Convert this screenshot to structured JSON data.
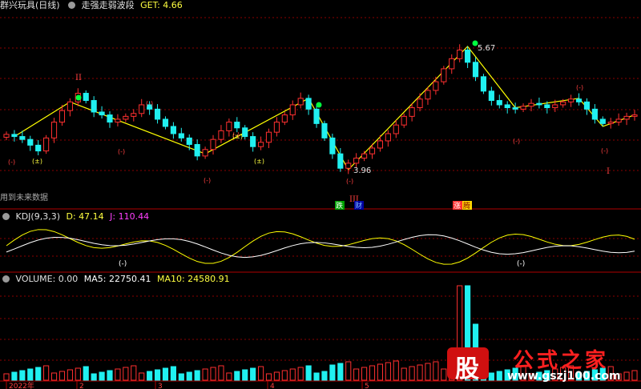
{
  "header": {
    "stock_name": "群兴玩具(日线)",
    "indicator_name": "走强走弱波段",
    "get_label": "GET: 4.66",
    "future_data_label": "用到未来数据"
  },
  "kdj_header": {
    "name": "KDJ(9,3,3)",
    "d_label": "D: 47.14",
    "j_label": "J: 110.44"
  },
  "volume_header": {
    "name": "VOLUME: 0.00",
    "ma5_label": "MA5: 22750.41",
    "ma10_label": "MA10: 24580.91"
  },
  "colors": {
    "up": "#ff3030",
    "down": "#20f0f0",
    "grid": "#8b0000",
    "zigzag": "#ffff00",
    "kdj_k": "#ffffff",
    "kdj_d": "#ffff00"
  },
  "annotations": {
    "price_high": "5.67",
    "price_low": "3.96",
    "roman_top": "II",
    "roman_bottom_left": "III",
    "roman_bottom_right": "I",
    "signal_down": "跌",
    "signal_buy": "财",
    "signal_up": "涨",
    "signal_soar": "腾",
    "kdj_marker_1": "(-)",
    "kdj_marker_2": "(-)"
  },
  "wave_labels": [
    "(±)",
    "(-)",
    "(-)",
    "(±)",
    "(-)",
    "(±)",
    "(-)",
    "(-)",
    "(-)",
    "(-)",
    "(-)",
    "(-)"
  ],
  "x_axis": {
    "ticks": [
      "2022年",
      "2",
      "3",
      "4",
      "5"
    ]
  },
  "watermark": {
    "logo_char": "股",
    "site_name": "公式之家",
    "url": "www.gszj100.com"
  },
  "chart_data": {
    "type": "candlestick",
    "close": [
      4.45,
      4.42,
      4.38,
      4.3,
      4.22,
      4.4,
      4.62,
      4.78,
      4.9,
      5.02,
      4.92,
      4.76,
      4.72,
      4.62,
      4.66,
      4.7,
      4.74,
      4.86,
      4.8,
      4.66,
      4.56,
      4.46,
      4.4,
      4.31,
      4.15,
      4.24,
      4.38,
      4.5,
      4.62,
      4.54,
      4.42,
      4.28,
      4.34,
      4.48,
      4.62,
      4.72,
      4.86,
      4.95,
      4.8,
      4.6,
      4.4,
      4.18,
      3.98,
      4.05,
      4.12,
      4.18,
      4.26,
      4.36,
      4.46,
      4.58,
      4.7,
      4.82,
      4.94,
      5.06,
      5.18,
      5.36,
      5.5,
      5.62,
      5.45,
      5.25,
      5.05,
      4.92,
      4.86,
      4.82,
      4.8,
      4.84,
      4.88,
      4.86,
      4.82,
      4.86,
      4.9,
      4.94,
      4.9,
      4.8,
      4.66,
      4.6,
      4.62,
      4.66,
      4.7,
      4.72
    ],
    "ma_period_labels": {
      "kdj": "KDJ(9,3,3)",
      "volume": "VOLUME"
    },
    "zigzag_points": [
      [
        1,
        4.42
      ],
      [
        8,
        4.9
      ],
      [
        25,
        4.18
      ],
      [
        38,
        4.95
      ],
      [
        43,
        3.96
      ],
      [
        58,
        5.67
      ],
      [
        64,
        4.82
      ],
      [
        72,
        4.95
      ],
      [
        75,
        4.56
      ],
      [
        79,
        4.72
      ]
    ],
    "kdj_values": {
      "D": 47.14,
      "J": 110.44
    },
    "volume_values": {
      "VOLUME": 0.0,
      "MA5": 22750.41,
      "MA10": 24580.91
    }
  }
}
